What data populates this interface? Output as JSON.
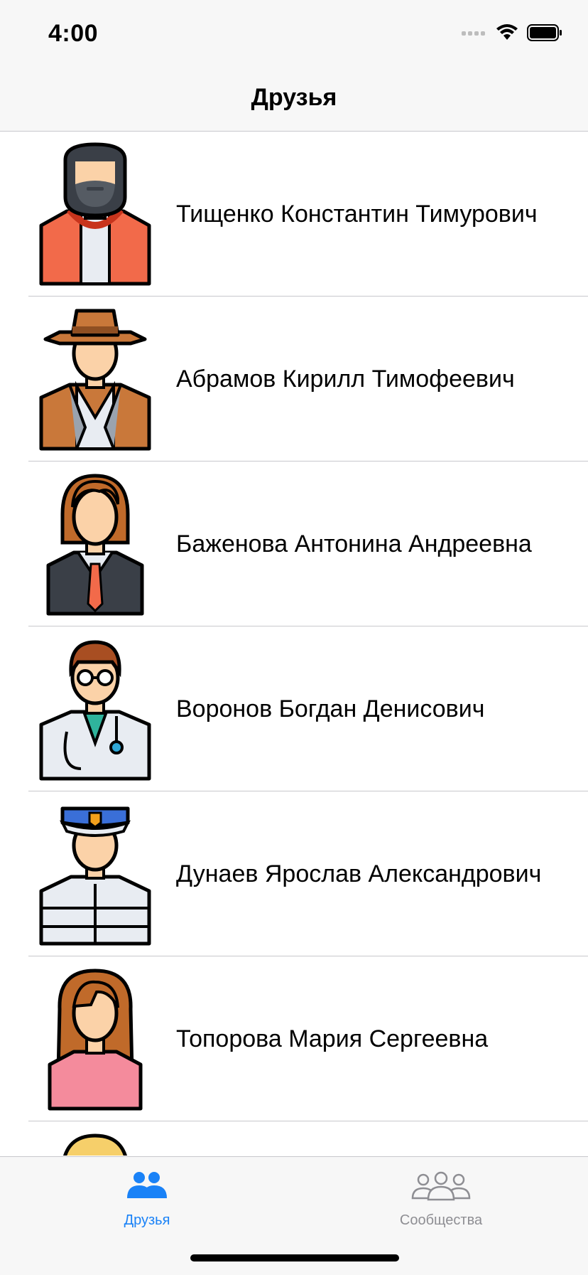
{
  "status_bar": {
    "time": "4:00"
  },
  "nav": {
    "title": "Друзья"
  },
  "friends": [
    {
      "name": "Тищенко Константин Тимурович",
      "avatar": "bearded-man-avatar"
    },
    {
      "name": "Абрамов Кирилл Тимофеевич",
      "avatar": "cowboy-avatar"
    },
    {
      "name": "Баженова Антонина Андреевна",
      "avatar": "businesswoman-avatar"
    },
    {
      "name": "Воронов Богдан Денисович",
      "avatar": "doctor-avatar"
    },
    {
      "name": "Дунаев Ярослав Александрович",
      "avatar": "police-officer-avatar"
    },
    {
      "name": "Топорова Мария Сергеевна",
      "avatar": "woman-avatar"
    }
  ],
  "tabs": [
    {
      "label": "Друзья",
      "icon": "friends-icon",
      "selected": true
    },
    {
      "label": "Сообщества",
      "icon": "communities-icon",
      "selected": false
    }
  ],
  "colors": {
    "accent": "#1a82f7",
    "inactive": "#8e8e93",
    "bar_bg": "#f7f7f7",
    "separator": "#c8c8cc"
  }
}
